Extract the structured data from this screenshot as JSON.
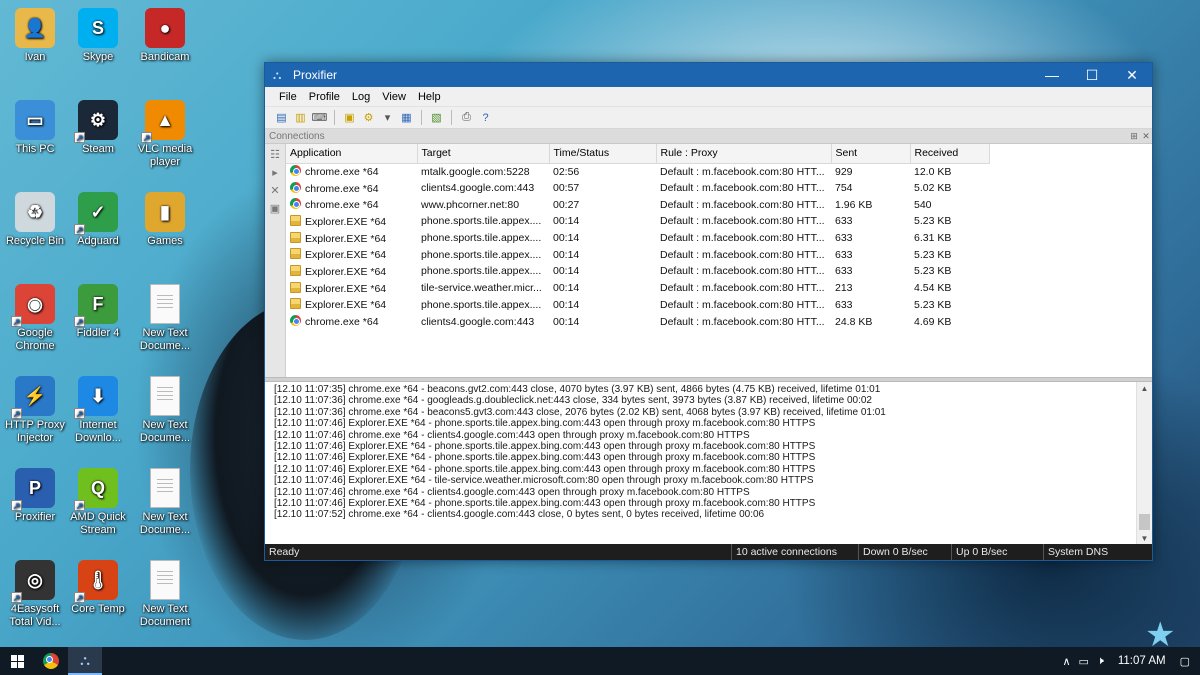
{
  "desktop": {
    "icons": [
      {
        "label": "Ivan",
        "icon": "user-folder-icon",
        "color": "#e8b84a",
        "glyph": "👤"
      },
      {
        "label": "Skype",
        "icon": "skype-icon",
        "color": "#00aff0",
        "glyph": "S"
      },
      {
        "label": "Bandicam",
        "icon": "bandicam-icon",
        "color": "#c62828",
        "glyph": "●"
      },
      {
        "label": "This PC",
        "icon": "computer-icon",
        "color": "#3a8fd8",
        "glyph": "▭"
      },
      {
        "label": "Steam",
        "icon": "steam-icon",
        "color": "#1b2838",
        "glyph": "⚙"
      },
      {
        "label": "VLC media player",
        "icon": "vlc-icon",
        "color": "#f08a00",
        "glyph": "▲"
      },
      {
        "label": "Recycle Bin",
        "icon": "recycle-bin-icon",
        "color": "#cfd8dc",
        "glyph": "♻"
      },
      {
        "label": "Adguard",
        "icon": "adguard-icon",
        "color": "#2e9e4a",
        "glyph": "✓"
      },
      {
        "label": "Games",
        "icon": "games-folder-icon",
        "color": "#e0a72e",
        "glyph": "▮"
      },
      {
        "label": "Google Chrome",
        "icon": "chrome-icon",
        "color": "#db4437",
        "glyph": "◉"
      },
      {
        "label": "Fiddler 4",
        "icon": "fiddler-icon",
        "color": "#3c9b3c",
        "glyph": "F"
      },
      {
        "label": "New Text Docume...",
        "icon": "text-document-icon",
        "color": "#fafafa",
        "glyph": ""
      },
      {
        "label": "HTTP Proxy Injector",
        "icon": "proxy-injector-icon",
        "color": "#2a78c8",
        "glyph": "⚡"
      },
      {
        "label": "Internet Downlo...",
        "icon": "idm-icon",
        "color": "#1e88e5",
        "glyph": "⬇"
      },
      {
        "label": "New Text Docume...",
        "icon": "text-document-icon",
        "color": "#fafafa",
        "glyph": ""
      },
      {
        "label": "Proxifier",
        "icon": "proxifier-icon",
        "color": "#2a5fb0",
        "glyph": "P"
      },
      {
        "label": "AMD Quick Stream",
        "icon": "amd-quickstream-icon",
        "color": "#6fbf1f",
        "glyph": "Q"
      },
      {
        "label": "New Text Docume...",
        "icon": "text-document-icon",
        "color": "#fafafa",
        "glyph": ""
      },
      {
        "label": "4Easysoft Total Vid...",
        "icon": "video-converter-icon",
        "color": "#333333",
        "glyph": "◎"
      },
      {
        "label": "Core Temp",
        "icon": "thermometer-icon",
        "color": "#d84315",
        "glyph": "🌡"
      },
      {
        "label": "New Text Document",
        "icon": "text-document-icon",
        "color": "#fafafa",
        "glyph": ""
      }
    ]
  },
  "window": {
    "title": "Proxifier",
    "menu": [
      "File",
      "Profile",
      "Log",
      "View",
      "Help"
    ],
    "connections_pane_title": "Connections",
    "columns": [
      "Application",
      "Target",
      "Time/Status",
      "Rule : Proxy",
      "Sent",
      "Received"
    ],
    "rows": [
      {
        "app": "chrome.exe *64",
        "icon": "chrome",
        "target": "mtalk.google.com:5228",
        "time": "02:56",
        "rule": "Default : m.facebook.com:80 HTT...",
        "sent": "929",
        "received": "12.0 KB"
      },
      {
        "app": "chrome.exe *64",
        "icon": "chrome",
        "target": "clients4.google.com:443",
        "time": "00:57",
        "rule": "Default : m.facebook.com:80 HTT...",
        "sent": "754",
        "received": "5.02 KB"
      },
      {
        "app": "chrome.exe *64",
        "icon": "chrome",
        "target": "www.phcorner.net:80",
        "time": "00:27",
        "rule": "Default : m.facebook.com:80 HTT...",
        "sent": "1.96 KB",
        "received": "540"
      },
      {
        "app": "Explorer.EXE *64",
        "icon": "explorer",
        "target": "phone.sports.tile.appex....",
        "time": "00:14",
        "rule": "Default : m.facebook.com:80 HTT...",
        "sent": "633",
        "received": "5.23 KB"
      },
      {
        "app": "Explorer.EXE *64",
        "icon": "explorer",
        "target": "phone.sports.tile.appex....",
        "time": "00:14",
        "rule": "Default : m.facebook.com:80 HTT...",
        "sent": "633",
        "received": "6.31 KB"
      },
      {
        "app": "Explorer.EXE *64",
        "icon": "explorer",
        "target": "phone.sports.tile.appex....",
        "time": "00:14",
        "rule": "Default : m.facebook.com:80 HTT...",
        "sent": "633",
        "received": "5.23 KB"
      },
      {
        "app": "Explorer.EXE *64",
        "icon": "explorer",
        "target": "phone.sports.tile.appex....",
        "time": "00:14",
        "rule": "Default : m.facebook.com:80 HTT...",
        "sent": "633",
        "received": "5.23 KB"
      },
      {
        "app": "Explorer.EXE *64",
        "icon": "explorer",
        "target": "tile-service.weather.micr...",
        "time": "00:14",
        "rule": "Default : m.facebook.com:80 HTT...",
        "sent": "213",
        "received": "4.54 KB"
      },
      {
        "app": "Explorer.EXE *64",
        "icon": "explorer",
        "target": "phone.sports.tile.appex....",
        "time": "00:14",
        "rule": "Default : m.facebook.com:80 HTT...",
        "sent": "633",
        "received": "5.23 KB"
      },
      {
        "app": "chrome.exe *64",
        "icon": "chrome",
        "target": "clients4.google.com:443",
        "time": "00:14",
        "rule": "Default : m.facebook.com:80 HTT...",
        "sent": "24.8 KB",
        "received": "4.69 KB"
      }
    ],
    "log": [
      "[12.10 11:07:35] chrome.exe *64 - beacons.gvt2.com:443 close, 4070 bytes (3.97 KB) sent, 4866 bytes (4.75 KB) received, lifetime 01:01",
      "[12.10 11:07:36] chrome.exe *64 - googleads.g.doubleclick.net:443 close, 334 bytes sent, 3973 bytes (3.87 KB) received, lifetime 00:02",
      "[12.10 11:07:36] chrome.exe *64 - beacons5.gvt3.com:443 close, 2076 bytes (2.02 KB) sent, 4068 bytes (3.97 KB) received, lifetime 01:01",
      "[12.10 11:07:46] Explorer.EXE *64 - phone.sports.tile.appex.bing.com:443 open through proxy m.facebook.com:80 HTTPS",
      "[12.10 11:07:46] chrome.exe *64 - clients4.google.com:443 open through proxy m.facebook.com:80 HTTPS",
      "[12.10 11:07:46] Explorer.EXE *64 - phone.sports.tile.appex.bing.com:443 open through proxy m.facebook.com:80 HTTPS",
      "[12.10 11:07:46] Explorer.EXE *64 - phone.sports.tile.appex.bing.com:443 open through proxy m.facebook.com:80 HTTPS",
      "[12.10 11:07:46] Explorer.EXE *64 - phone.sports.tile.appex.bing.com:443 open through proxy m.facebook.com:80 HTTPS",
      "[12.10 11:07:46] Explorer.EXE *64 - tile-service.weather.microsoft.com:80 open through proxy m.facebook.com:80 HTTPS",
      "[12.10 11:07:46] chrome.exe *64 - clients4.google.com:443 open through proxy m.facebook.com:80 HTTPS",
      "[12.10 11:07:46] Explorer.EXE *64 - phone.sports.tile.appex.bing.com:443 open through proxy m.facebook.com:80 HTTPS",
      "[12.10 11:07:52] chrome.exe *64 - clients4.google.com:443 close, 0 bytes sent, 0 bytes received, lifetime 00:06"
    ],
    "status": {
      "state": "Ready",
      "connections": "10 active connections",
      "down": "Down 0 B/sec",
      "up": "Up 0 B/sec",
      "dns": "System DNS"
    }
  },
  "taskbar": {
    "clock": "11:07 AM"
  }
}
